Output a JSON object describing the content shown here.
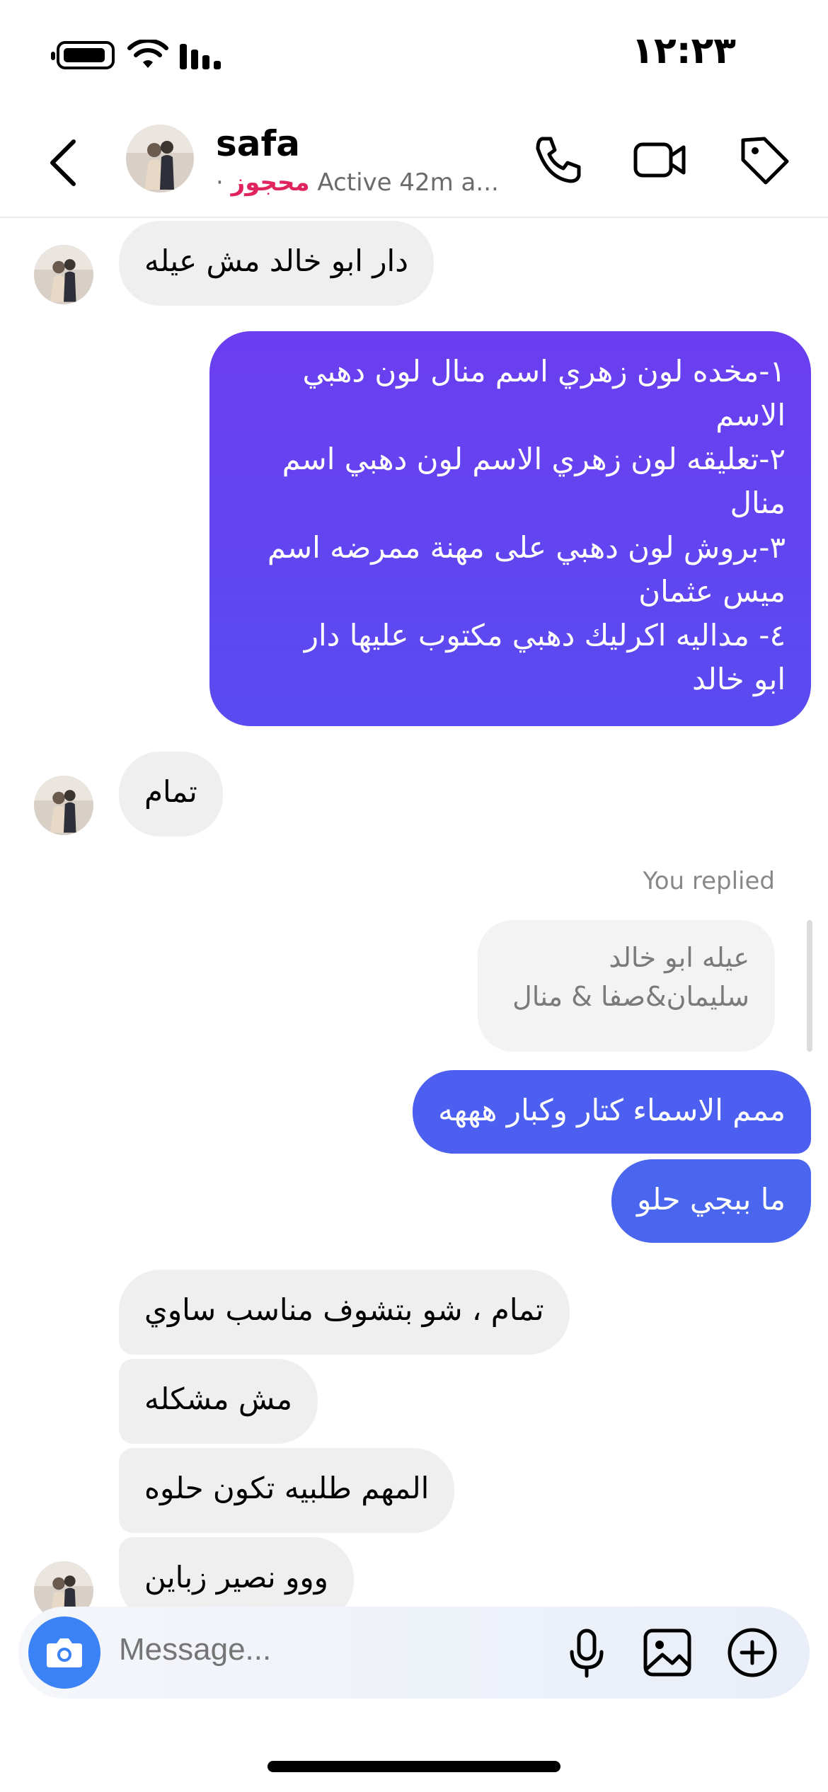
{
  "status_bar": {
    "time": "١٢:٢٣"
  },
  "header": {
    "name": "safa",
    "status_tag": "محجوز",
    "active_text": "Active 42m a..."
  },
  "messages": {
    "m1": "دار ابو خالد مش عيله",
    "m2": [
      "١-مخده لون زهري اسم منال لون دهبي",
      "الاسم",
      "٢-تعليقه لون زهري  الاسم لون دهبي اسم",
      "منال",
      "٣-بروش لون دهبي على مهنة ممرضه اسم",
      "ميس عثمان",
      "٤- مداليه اكرليك دهبي مكتوب عليها دار",
      "ابو خالد"
    ],
    "m3": "تمام",
    "reply_label": "You replied",
    "reply_quote": [
      "عيله ابو خالد",
      "سليمان&صفا & منال"
    ],
    "m4": "ممم الاسماء كتار وكبار هههه",
    "m5": "ما ببجي حلو",
    "m6": "تمام ، شو بتشوف مناسب ساوي",
    "m7": "مش مشكله",
    "m8": "المهم طلبيه تكون حلوه",
    "m9": "ووو نصير زباين"
  },
  "composer": {
    "placeholder": "Message..."
  },
  "colors": {
    "outgoing_gradient_top": "#6b3ef0",
    "outgoing_gradient_bottom": "#5a4bf0",
    "outgoing_blue": "#4a66ee",
    "incoming_bg": "#efefef",
    "accent_pink": "#e0245e",
    "camera_blue": "#3b82f6"
  },
  "icons": [
    "battery-icon",
    "wifi-icon",
    "signal-icon",
    "back-icon",
    "phone-icon",
    "video-icon",
    "tag-icon",
    "camera-icon",
    "microphone-icon",
    "gallery-icon",
    "plus-circle-icon"
  ]
}
